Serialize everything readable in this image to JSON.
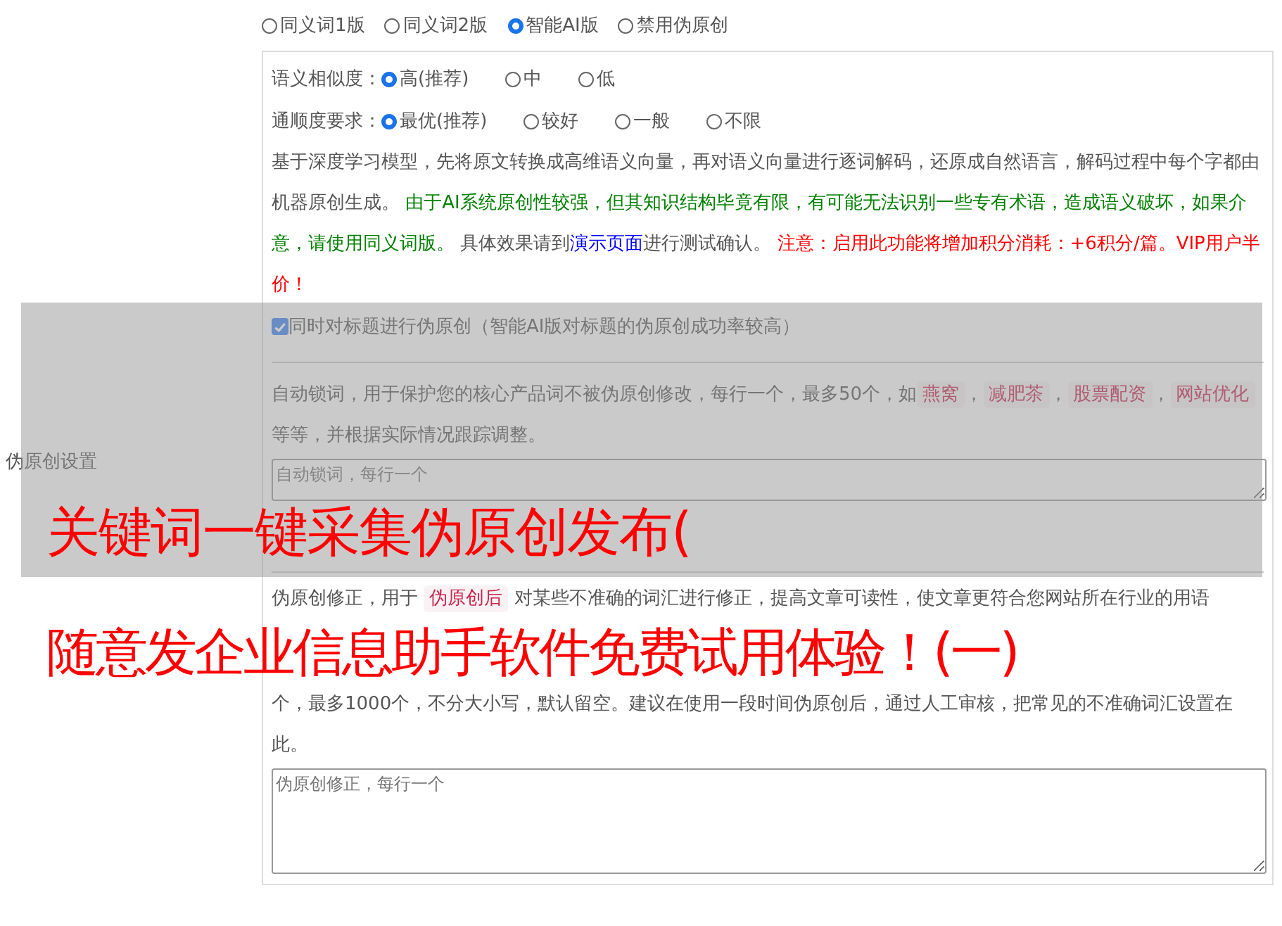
{
  "section_label": "伪原创设置",
  "modes": [
    {
      "label": "同义词1版",
      "selected": false
    },
    {
      "label": "同义词2版",
      "selected": false
    },
    {
      "label": "智能AI版",
      "selected": true
    },
    {
      "label": "禁用伪原创",
      "selected": false
    }
  ],
  "similarity": {
    "label": "语义相似度：",
    "options": [
      {
        "label": "高(推荐)",
        "selected": true
      },
      {
        "label": "中",
        "selected": false
      },
      {
        "label": "低",
        "selected": false
      }
    ]
  },
  "fluency": {
    "label": "通顺度要求：",
    "options": [
      {
        "label": "最优(推荐)",
        "selected": true
      },
      {
        "label": "较好",
        "selected": false
      },
      {
        "label": "一般",
        "selected": false
      },
      {
        "label": "不限",
        "selected": false
      }
    ]
  },
  "description": [
    {
      "kind": "text",
      "text": "基于深度学习模型，先将原文转换成高维语义向量，再对语义向量进行逐词解码，还原成自然语言，解码过程中每个字都由机器原创生成。 "
    },
    {
      "kind": "caution",
      "text": "由于AI系统原创性较强，但其知识结构毕竟有限，有可能无法识别一些专有术语，造成语义破坏，如果介意，请使用同义词版。"
    },
    {
      "kind": "text",
      "text": " 具体效果请到"
    },
    {
      "kind": "link",
      "text": "演示页面"
    },
    {
      "kind": "text",
      "text": "进行测试确认。 "
    },
    {
      "kind": "warning",
      "text": "注意：启用此功能将增加积分消耗：+6积分/篇。VIP用户半价！"
    }
  ],
  "title_option": {
    "label": "同时对标题进行伪原创（智能AI版对标题的伪原创成功率较高）",
    "checked": true
  },
  "lock_words": {
    "parts": [
      {
        "kind": "text",
        "text": "自动锁词，用于保护您的核心产品词不被伪原创修改，每行一个，最多50个，如"
      },
      {
        "kind": "tag",
        "text": "燕窝"
      },
      {
        "kind": "text",
        "text": "，"
      },
      {
        "kind": "tag",
        "text": "减肥茶"
      },
      {
        "kind": "text",
        "text": "，"
      },
      {
        "kind": "tag",
        "text": "股票配资"
      },
      {
        "kind": "text",
        "text": "，"
      },
      {
        "kind": "tag",
        "text": "网站优化"
      },
      {
        "kind": "text",
        "text": " 等等，并根据实际情况跟踪调整。"
      }
    ],
    "placeholder": "自动锁词，每行一个"
  },
  "correction": {
    "parts": [
      {
        "kind": "text",
        "text": "伪原创修正，用于 "
      },
      {
        "kind": "tag",
        "text": "伪原创后"
      },
      {
        "kind": "text",
        "text": " 对某些不准确的词汇进行修正，提高文章可读性，使文章更符合您网站所在行业的用语"
      }
    ],
    "tail": "个，最多1000个，不分大小写，默认留空。建议在使用一段时间伪原创后，通过人工审核，把常见的不准确词汇设置在此。",
    "placeholder": "伪原创修正，每行一个"
  },
  "overlay_titles": [
    "关键词一键采集伪原创发布(",
    "随意发企业信息助手软件免费试用体验！(一)"
  ]
}
